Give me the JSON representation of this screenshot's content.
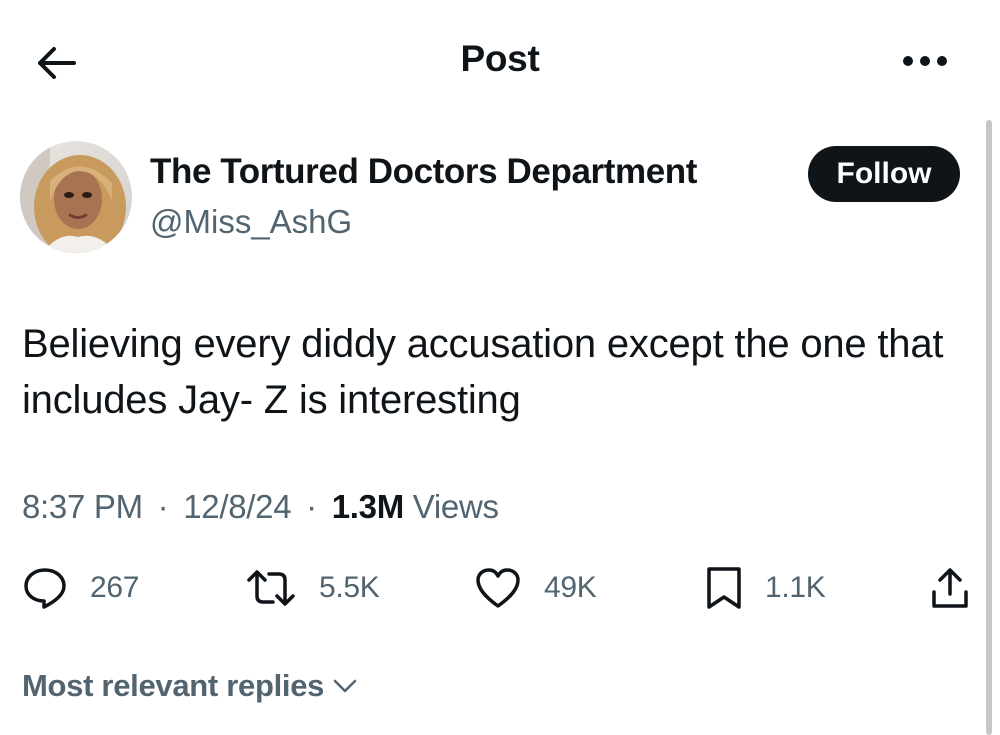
{
  "header": {
    "title": "Post",
    "back_icon": "arrow-left-icon",
    "more_icon": "ellipsis-icon"
  },
  "author": {
    "display_name": "The Tortured Doctors Department",
    "handle": "@Miss_AshG",
    "follow_label": "Follow"
  },
  "post": {
    "text": "Believing every diddy accusation except the one that includes Jay- Z is interesting",
    "time": "8:37 PM",
    "date": "12/8/24",
    "separator": "·",
    "views_count": "1.3M",
    "views_label": "Views"
  },
  "actions": {
    "replies": "267",
    "reposts": "5.5K",
    "likes": "49K",
    "bookmarks": "1.1K"
  },
  "replies_filter": {
    "label": "Most relevant replies"
  },
  "colors": {
    "text_primary": "#0f1419",
    "text_secondary": "#536471",
    "follow_bg": "#0f1419",
    "background": "#ffffff"
  }
}
